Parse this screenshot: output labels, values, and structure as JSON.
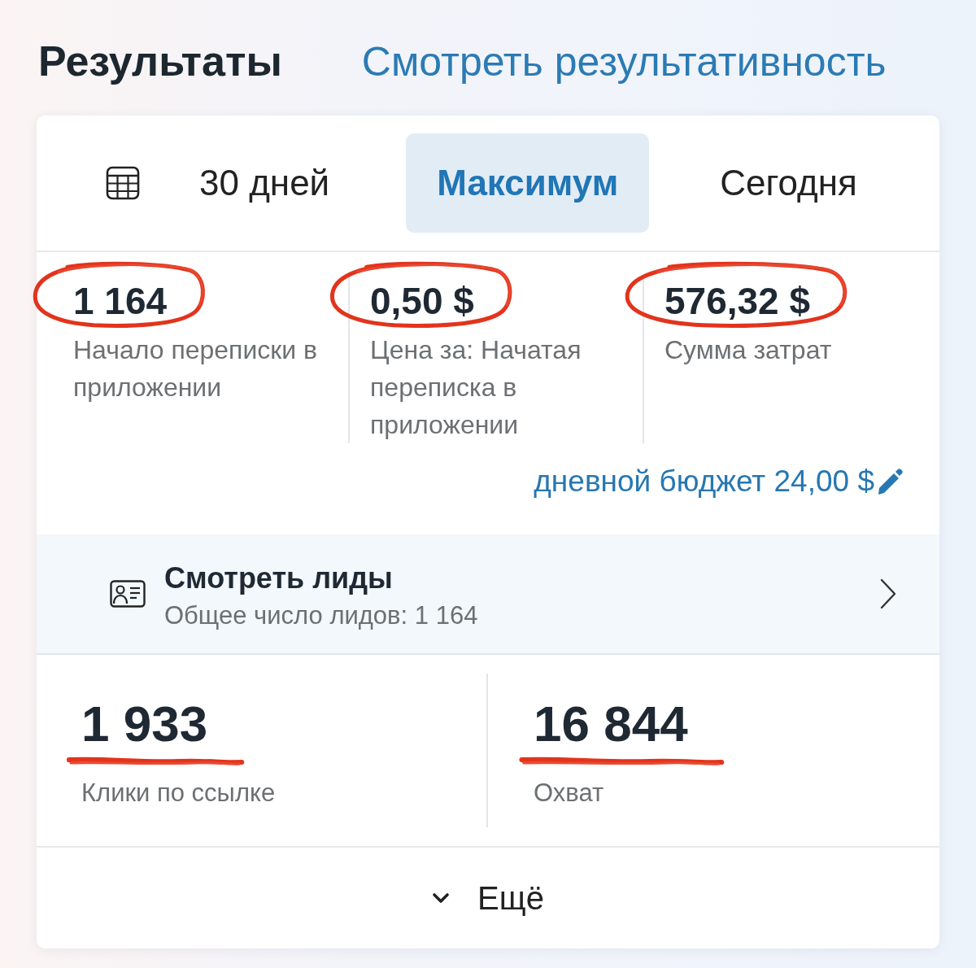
{
  "header": {
    "title": "Результаты",
    "link": "Смотреть результативность"
  },
  "period_tabs": [
    {
      "label": "30 дней",
      "selected": false
    },
    {
      "label": "Максимум",
      "selected": true
    },
    {
      "label": "Сегодня",
      "selected": false
    }
  ],
  "metrics": [
    {
      "value": "1 164",
      "label": "Начало переписки в приложении",
      "circled": true
    },
    {
      "value": "0,50 $",
      "label": "Цена за: Начатая переписка в приложении",
      "circled": true
    },
    {
      "value": "576,32 $",
      "label": "Сумма затрат",
      "circled": true
    }
  ],
  "daily_budget": {
    "text": "дневной бюджет 24,00 $"
  },
  "leads": {
    "title": "Смотреть лиды",
    "subtitle": "Общее число лидов: 1 164"
  },
  "stats": [
    {
      "value": "1 933",
      "label": "Клики по ссылке",
      "underlined": true
    },
    {
      "value": "16 844",
      "label": "Охват",
      "underlined": true
    }
  ],
  "more_button": {
    "label": "Ещё"
  }
}
